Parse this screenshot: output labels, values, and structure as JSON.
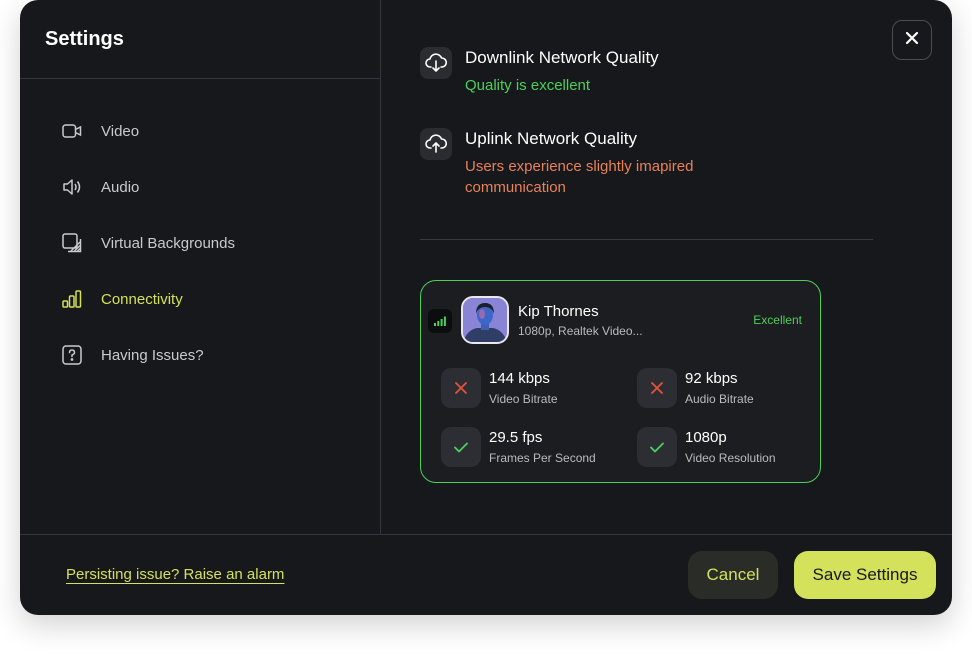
{
  "sidebar": {
    "title": "Settings",
    "items": [
      {
        "label": "Video",
        "icon": "video-icon"
      },
      {
        "label": "Audio",
        "icon": "speaker-icon"
      },
      {
        "label": "Virtual Backgrounds",
        "icon": "background-icon"
      },
      {
        "label": "Connectivity",
        "icon": "signal-bars-icon",
        "active": true
      },
      {
        "label": "Having Issues?",
        "icon": "question-icon"
      }
    ]
  },
  "downlink": {
    "title": "Downlink Network Quality",
    "status": "Quality is excellent",
    "icon": "cloud-download-icon"
  },
  "uplink": {
    "title": "Uplink Network Quality",
    "status": "Users experience slightly imapired communication",
    "icon": "cloud-upload-icon"
  },
  "participant": {
    "name": "Kip Thornes",
    "device": "1080p, Realtek Video...",
    "status": "Excellent",
    "stats": [
      {
        "value": "144 kbps",
        "label": "Video Bitrate",
        "ok": false
      },
      {
        "value": "92 kbps",
        "label": "Audio Bitrate",
        "ok": false
      },
      {
        "value": "29.5 fps",
        "label": "Frames Per Second",
        "ok": true
      },
      {
        "value": "1080p",
        "label": "Video Resolution",
        "ok": true
      }
    ]
  },
  "footer": {
    "alarm_link": "Persisting issue? Raise an alarm",
    "cancel_label": "Cancel",
    "save_label": "Save Settings"
  },
  "colors": {
    "accent": "#d4e15a",
    "good": "#4bd05b",
    "warn": "#e7815a",
    "bad": "#e5533c",
    "background": "#17181b"
  }
}
